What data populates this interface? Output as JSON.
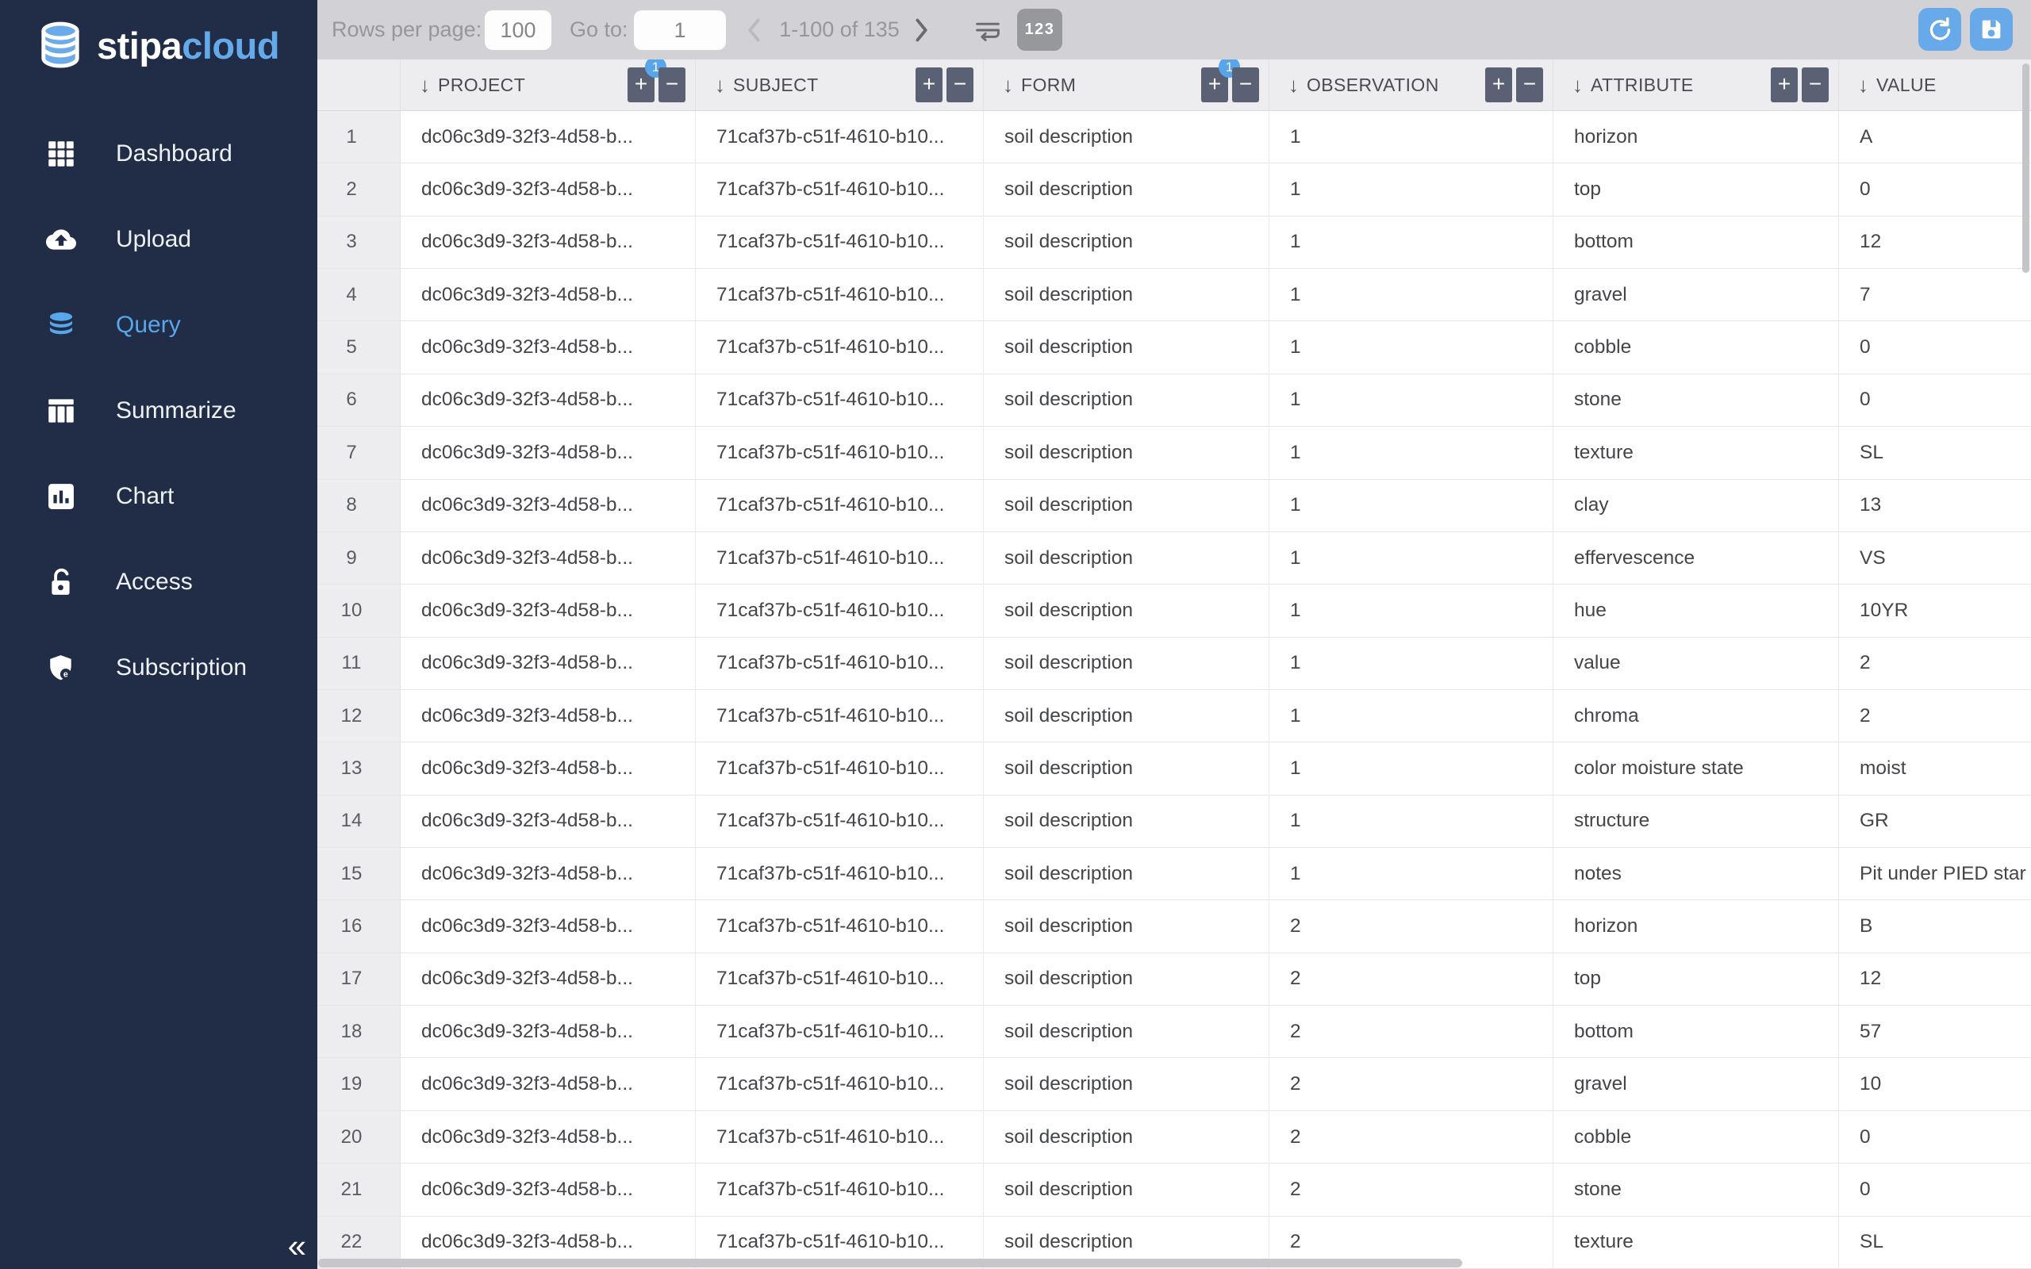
{
  "brand": {
    "name_primary": "stipa",
    "name_secondary": "cloud"
  },
  "sidebar": {
    "items": [
      {
        "label": "Dashboard",
        "icon": "grid-icon",
        "active": false
      },
      {
        "label": "Upload",
        "icon": "cloud-upload-icon",
        "active": false
      },
      {
        "label": "Query",
        "icon": "database-icon",
        "active": true
      },
      {
        "label": "Summarize",
        "icon": "columns-icon",
        "active": false
      },
      {
        "label": "Chart",
        "icon": "bar-chart-icon",
        "active": false
      },
      {
        "label": "Access",
        "icon": "lock-open-icon",
        "active": false
      },
      {
        "label": "Subscription",
        "icon": "shield-icon",
        "active": false
      }
    ],
    "collapse_glyph": "«"
  },
  "topbar": {
    "rows_per_page_label": "Rows per page:",
    "rows_per_page_value": "100",
    "goto_label": "Go to:",
    "goto_value": "1",
    "range_text": "1-100 of 135",
    "numeric_button_label": "123"
  },
  "table": {
    "columns": [
      {
        "key": "num",
        "label": ""
      },
      {
        "key": "project",
        "label": "PROJECT",
        "sort": "desc",
        "badge": "1"
      },
      {
        "key": "subject",
        "label": "SUBJECT",
        "sort": "desc"
      },
      {
        "key": "form",
        "label": "FORM",
        "sort": "desc",
        "badge": "1"
      },
      {
        "key": "observation",
        "label": "OBSERVATION",
        "sort": "desc"
      },
      {
        "key": "attribute",
        "label": "ATTRIBUTE",
        "sort": "desc"
      },
      {
        "key": "value",
        "label": "VALUE",
        "sort": "desc"
      }
    ],
    "rows": [
      {
        "num": "1",
        "project": "dc06c3d9-32f3-4d58-b...",
        "subject": "71caf37b-c51f-4610-b10...",
        "form": "soil description",
        "observation": "1",
        "attribute": "horizon",
        "value": "A"
      },
      {
        "num": "2",
        "project": "dc06c3d9-32f3-4d58-b...",
        "subject": "71caf37b-c51f-4610-b10...",
        "form": "soil description",
        "observation": "1",
        "attribute": "top",
        "value": "0"
      },
      {
        "num": "3",
        "project": "dc06c3d9-32f3-4d58-b...",
        "subject": "71caf37b-c51f-4610-b10...",
        "form": "soil description",
        "observation": "1",
        "attribute": "bottom",
        "value": "12"
      },
      {
        "num": "4",
        "project": "dc06c3d9-32f3-4d58-b...",
        "subject": "71caf37b-c51f-4610-b10...",
        "form": "soil description",
        "observation": "1",
        "attribute": "gravel",
        "value": "7"
      },
      {
        "num": "5",
        "project": "dc06c3d9-32f3-4d58-b...",
        "subject": "71caf37b-c51f-4610-b10...",
        "form": "soil description",
        "observation": "1",
        "attribute": "cobble",
        "value": "0"
      },
      {
        "num": "6",
        "project": "dc06c3d9-32f3-4d58-b...",
        "subject": "71caf37b-c51f-4610-b10...",
        "form": "soil description",
        "observation": "1",
        "attribute": "stone",
        "value": "0"
      },
      {
        "num": "7",
        "project": "dc06c3d9-32f3-4d58-b...",
        "subject": "71caf37b-c51f-4610-b10...",
        "form": "soil description",
        "observation": "1",
        "attribute": "texture",
        "value": "SL"
      },
      {
        "num": "8",
        "project": "dc06c3d9-32f3-4d58-b...",
        "subject": "71caf37b-c51f-4610-b10...",
        "form": "soil description",
        "observation": "1",
        "attribute": "clay",
        "value": "13"
      },
      {
        "num": "9",
        "project": "dc06c3d9-32f3-4d58-b...",
        "subject": "71caf37b-c51f-4610-b10...",
        "form": "soil description",
        "observation": "1",
        "attribute": "effervescence",
        "value": "VS"
      },
      {
        "num": "10",
        "project": "dc06c3d9-32f3-4d58-b...",
        "subject": "71caf37b-c51f-4610-b10...",
        "form": "soil description",
        "observation": "1",
        "attribute": "hue",
        "value": "10YR"
      },
      {
        "num": "11",
        "project": "dc06c3d9-32f3-4d58-b...",
        "subject": "71caf37b-c51f-4610-b10...",
        "form": "soil description",
        "observation": "1",
        "attribute": "value",
        "value": "2"
      },
      {
        "num": "12",
        "project": "dc06c3d9-32f3-4d58-b...",
        "subject": "71caf37b-c51f-4610-b10...",
        "form": "soil description",
        "observation": "1",
        "attribute": "chroma",
        "value": "2"
      },
      {
        "num": "13",
        "project": "dc06c3d9-32f3-4d58-b...",
        "subject": "71caf37b-c51f-4610-b10...",
        "form": "soil description",
        "observation": "1",
        "attribute": "color moisture state",
        "value": "moist"
      },
      {
        "num": "14",
        "project": "dc06c3d9-32f3-4d58-b...",
        "subject": "71caf37b-c51f-4610-b10...",
        "form": "soil description",
        "observation": "1",
        "attribute": "structure",
        "value": "GR"
      },
      {
        "num": "15",
        "project": "dc06c3d9-32f3-4d58-b...",
        "subject": "71caf37b-c51f-4610-b10...",
        "form": "soil description",
        "observation": "1",
        "attribute": "notes",
        "value": "Pit under PIED star"
      },
      {
        "num": "16",
        "project": "dc06c3d9-32f3-4d58-b...",
        "subject": "71caf37b-c51f-4610-b10...",
        "form": "soil description",
        "observation": "2",
        "attribute": "horizon",
        "value": "B"
      },
      {
        "num": "17",
        "project": "dc06c3d9-32f3-4d58-b...",
        "subject": "71caf37b-c51f-4610-b10...",
        "form": "soil description",
        "observation": "2",
        "attribute": "top",
        "value": "12"
      },
      {
        "num": "18",
        "project": "dc06c3d9-32f3-4d58-b...",
        "subject": "71caf37b-c51f-4610-b10...",
        "form": "soil description",
        "observation": "2",
        "attribute": "bottom",
        "value": "57"
      },
      {
        "num": "19",
        "project": "dc06c3d9-32f3-4d58-b...",
        "subject": "71caf37b-c51f-4610-b10...",
        "form": "soil description",
        "observation": "2",
        "attribute": "gravel",
        "value": "10"
      },
      {
        "num": "20",
        "project": "dc06c3d9-32f3-4d58-b...",
        "subject": "71caf37b-c51f-4610-b10...",
        "form": "soil description",
        "observation": "2",
        "attribute": "cobble",
        "value": "0"
      },
      {
        "num": "21",
        "project": "dc06c3d9-32f3-4d58-b...",
        "subject": "71caf37b-c51f-4610-b10...",
        "form": "soil description",
        "observation": "2",
        "attribute": "stone",
        "value": "0"
      },
      {
        "num": "22",
        "project": "dc06c3d9-32f3-4d58-b...",
        "subject": "71caf37b-c51f-4610-b10...",
        "form": "soil description",
        "observation": "2",
        "attribute": "texture",
        "value": "SL"
      }
    ]
  },
  "colors": {
    "sidebar_bg": "#212c47",
    "accent_blue": "#58a7ea",
    "badge_blue": "#58a5e9",
    "topbar_bg": "#d2d2d6",
    "header_bg": "#ededf0",
    "header_button_bg": "#5a6174"
  }
}
